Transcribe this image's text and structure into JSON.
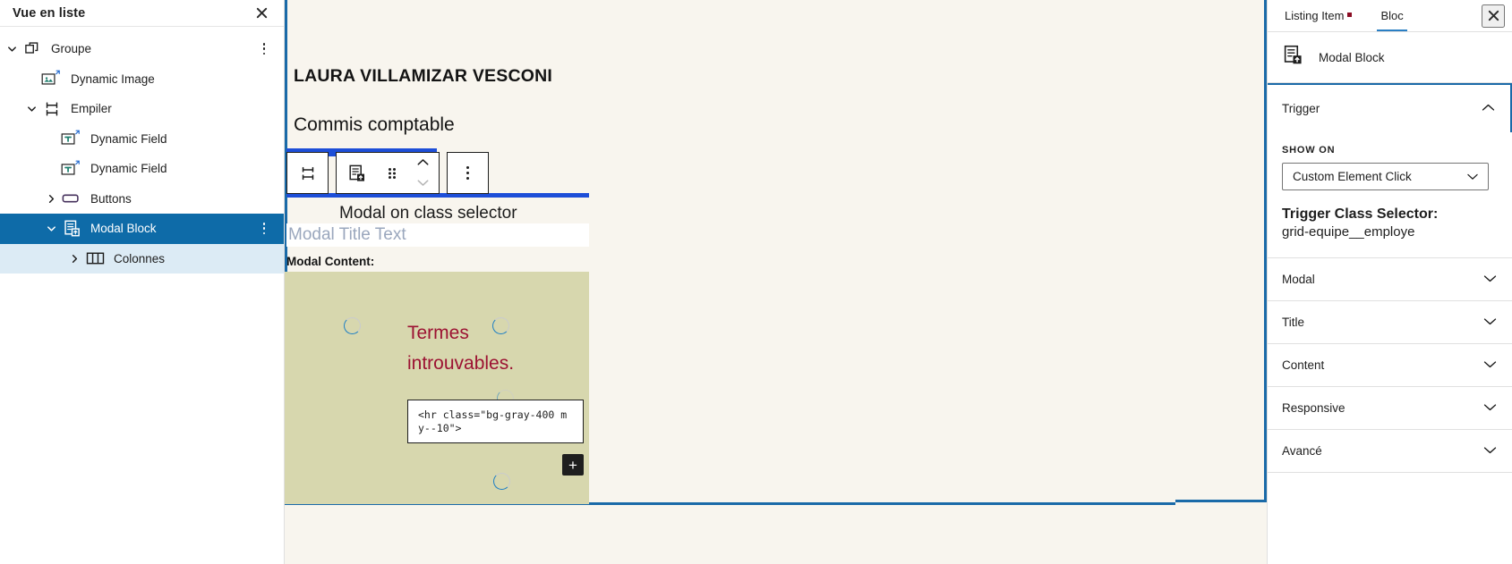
{
  "list_view": {
    "title": "Vue en liste",
    "close_icon": "close-icon",
    "items": [
      {
        "label": "Groupe",
        "icon": "group-blocks-icon",
        "indent": 0,
        "caret": "down",
        "state": "normal",
        "has_more": true
      },
      {
        "label": "Dynamic Image",
        "icon": "dynamic-image-icon",
        "indent": 1,
        "caret": "none",
        "state": "normal",
        "has_more": false
      },
      {
        "label": "Empiler",
        "icon": "stack-icon",
        "indent": 1,
        "caret": "down",
        "state": "normal",
        "has_more": false
      },
      {
        "label": "Dynamic Field",
        "icon": "dynamic-field-icon",
        "indent": 2,
        "caret": "none",
        "state": "normal",
        "has_more": false
      },
      {
        "label": "Dynamic Field",
        "icon": "dynamic-field-icon",
        "indent": 2,
        "caret": "none",
        "state": "normal",
        "has_more": false
      },
      {
        "label": "Buttons",
        "icon": "buttons-icon",
        "indent": 2,
        "caret": "right",
        "state": "normal",
        "has_more": false
      },
      {
        "label": "Modal Block",
        "icon": "modal-block-icon",
        "indent": 2,
        "caret": "down",
        "state": "selected",
        "has_more": true
      },
      {
        "label": "Colonnes",
        "icon": "columns-icon",
        "indent": 3,
        "caret": "right",
        "state": "child",
        "has_more": false
      }
    ]
  },
  "canvas": {
    "post_title": "LAURA VILLAMIZAR VESCONI",
    "post_subtitle": "Commis comptable",
    "modal_heading": "Modal on class selector",
    "modal_title_placeholder": "Modal Title Text",
    "modal_content_label": "Modal Content:",
    "error_text": "Termes introuvables.",
    "code_snippet": "<hr class=\"bg-gray-400 my--10\">",
    "appender_label": "+",
    "toolbar": {
      "parent_block_icon": "stack-icon",
      "block_type_icon": "modal-block-icon",
      "drag_icon": "drag-handle-icon",
      "move_up_icon": "chevron-up-icon",
      "move_down_icon": "chevron-down-icon",
      "options_icon": "more-options-icon"
    },
    "colors": {
      "canvas_bg": "#f8f5ee",
      "modal_body_bg": "#d7d7ae",
      "error_text": "#9c1232",
      "selection_blue": "#1a6aa8",
      "toolbar_blue": "#1d4ed8",
      "appender_bg": "#1e1e1e"
    }
  },
  "settings": {
    "tabs": [
      {
        "label": "Listing Item",
        "active": false,
        "has_dot": true
      },
      {
        "label": "Bloc",
        "active": true,
        "has_dot": false
      }
    ],
    "close_icon": "close-icon",
    "block_card": {
      "icon": "modal-block-icon",
      "name": "Modal Block"
    },
    "trigger": {
      "title": "Trigger",
      "expanded": true,
      "chevron": "chevron-up-icon",
      "show_on_label": "SHOW ON",
      "show_on_value": "Custom Element Click",
      "show_on_chevron": "chevron-down-icon",
      "class_selector_label": "Trigger Class Selector:",
      "class_selector_value": "grid-equipe__employe"
    },
    "sections": [
      {
        "label": "Modal",
        "chevron": "chevron-down-icon"
      },
      {
        "label": "Title",
        "chevron": "chevron-down-icon"
      },
      {
        "label": "Content",
        "chevron": "chevron-down-icon"
      },
      {
        "label": "Responsive",
        "chevron": "chevron-down-icon"
      },
      {
        "label": "Avancé",
        "chevron": "chevron-down-icon"
      }
    ],
    "colors": {
      "focus_outline": "#1a6aa8",
      "active_tab_underline": "#2a7fc4",
      "tab_dot": "#8b0d24"
    }
  }
}
